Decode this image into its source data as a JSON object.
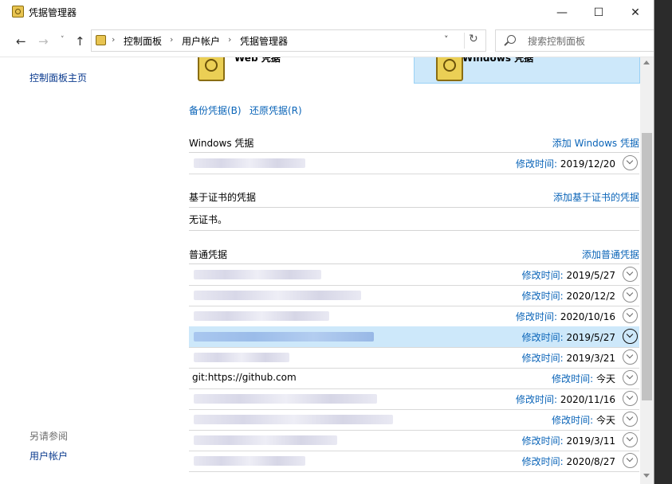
{
  "window": {
    "title": "凭据管理器",
    "min_glyph": "—",
    "max_glyph": "☐",
    "close_glyph": "✕"
  },
  "nav": {
    "back_glyph": "←",
    "forward_glyph": "→",
    "recent_glyph": "˅",
    "up_glyph": "↑"
  },
  "address": {
    "crumbs": [
      "控制面板",
      "用户帐户",
      "凭据管理器"
    ],
    "separator": "›",
    "dropdown_glyph": "˅",
    "refresh_glyph": "↻"
  },
  "search": {
    "placeholder": "搜索控制面板"
  },
  "sidebar": {
    "home_link": "控制面板主页",
    "see_also_heading": "另请参阅",
    "see_also_links": [
      "用户帐户"
    ]
  },
  "tiles": {
    "web": "Web 凭据",
    "windows": "Windows 凭据"
  },
  "actions": {
    "backup": "备份凭据(B)",
    "restore": "还原凭据(R)"
  },
  "windows_section": {
    "title": "Windows 凭据",
    "add": "添加 Windows 凭据",
    "rows": [
      {
        "name": "",
        "modified_label": "修改时间:",
        "date": "2019/12/20"
      }
    ]
  },
  "cert_section": {
    "title": "基于证书的凭据",
    "add": "添加基于证书的凭据",
    "empty": "无证书。"
  },
  "generic_section": {
    "title": "普通凭据",
    "add": "添加普通凭据",
    "rows": [
      {
        "name": "",
        "modified_label": "修改时间:",
        "date": "2019/5/27"
      },
      {
        "name": "",
        "modified_label": "修改时间:",
        "date": "2020/12/2"
      },
      {
        "name": "",
        "modified_label": "修改时间:",
        "date": "2020/10/16"
      },
      {
        "name": "",
        "modified_label": "修改时间:",
        "date": "2019/5/27",
        "selected": true
      },
      {
        "name": "",
        "modified_label": "修改时间:",
        "date": "2019/3/21"
      },
      {
        "name": "git:https://github.com",
        "modified_label": "修改时间:",
        "date": "今天"
      },
      {
        "name": "",
        "modified_label": "修改时间:",
        "date": "2020/11/16"
      },
      {
        "name": "",
        "modified_label": "修改时间:",
        "date": "今天"
      },
      {
        "name": "",
        "modified_label": "修改时间:",
        "date": "2019/3/11"
      },
      {
        "name": "",
        "modified_label": "修改时间:",
        "date": "2020/8/27"
      }
    ]
  },
  "colors": {
    "link": "#0a64b8",
    "selection": "#cde8fa",
    "window_bg": "#ffffff",
    "backdrop": "#2b2b2b"
  },
  "icons": [
    "credential-manager-icon",
    "vault-icon",
    "search-icon",
    "refresh-icon",
    "chevron-down-icon"
  ]
}
